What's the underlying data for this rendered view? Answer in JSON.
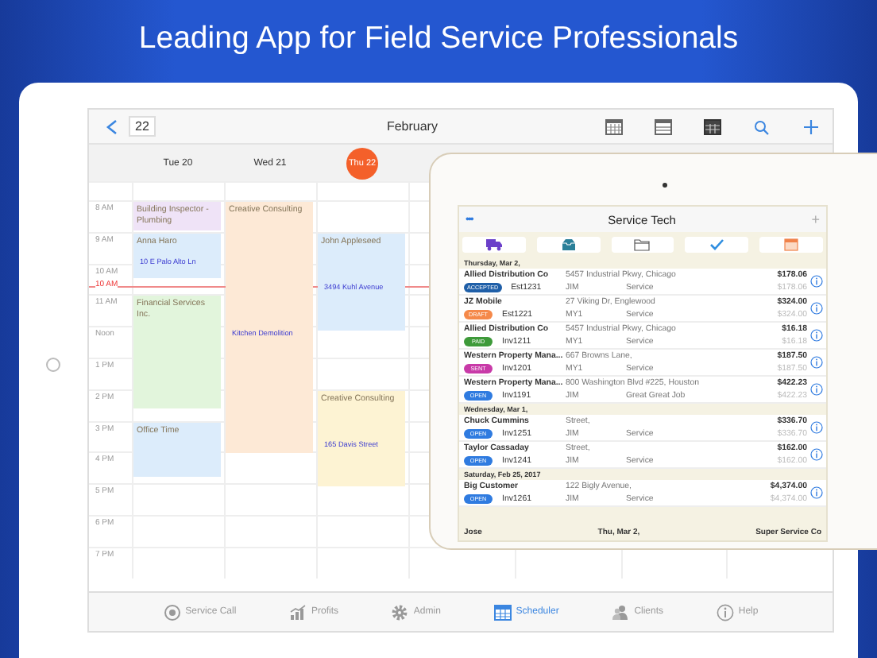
{
  "headline": "Leading App for Field Service Professionals",
  "calendar": {
    "date_box": "22",
    "month": "February",
    "days": [
      {
        "label": "Tue 20",
        "selected": false,
        "events": [
          {
            "title": "Building Inspector -Plumbing",
            "color": "#efe3f7"
          },
          {
            "title": "Anna Haro",
            "detail": "10 E Palo Alto Ln",
            "color": "#dcecfb"
          },
          {
            "title": "Financial Services Inc.",
            "color": "#e2f5dc"
          },
          {
            "title": "Office Time",
            "color": "#dcecfb"
          }
        ]
      },
      {
        "label": "Wed 21",
        "selected": false,
        "events": [
          {
            "title": "Creative Consulting",
            "detail": "Kitchen Demolition",
            "color": "#fde9d6"
          }
        ]
      },
      {
        "label": "Thu 22",
        "selected": true,
        "events": [
          {
            "title": "John Appleseed",
            "detail": "3494 Kuhl Avenue",
            "color": "#dcecfb"
          },
          {
            "title": "Creative Consulting",
            "detail": "165 Davis Street",
            "color": "#fdf3d3"
          }
        ]
      }
    ],
    "time_labels": [
      "8 AM",
      "9 AM",
      "10 AM",
      "11 AM",
      "Noon",
      "1 PM",
      "2 PM",
      "3 PM",
      "4 PM",
      "5 PM",
      "6 PM",
      "7 PM"
    ],
    "now_marker": "10 AM"
  },
  "tab_bar": [
    {
      "label": "Service Call",
      "selected": false
    },
    {
      "label": "Profits",
      "selected": false
    },
    {
      "label": "Admin",
      "selected": false
    },
    {
      "label": "Scheduler",
      "selected": true
    },
    {
      "label": "Clients",
      "selected": false
    },
    {
      "label": "Help",
      "selected": false
    }
  ],
  "service_tech": {
    "title": "Service Tech",
    "menu": "•••",
    "add": "+",
    "sections": [
      {
        "heading": "Thursday, Mar 2,",
        "rows": [
          {
            "name": "Allied Distribution Co",
            "address": "5457 Industrial Pkwy, Chicago",
            "amount": "$178.06",
            "status": "ACCEPTED",
            "color": "#1f5fa8",
            "number": "Est1231",
            "tech": "JIM",
            "job": "Service",
            "subtotal": "$178.06"
          },
          {
            "name": "JZ Mobile",
            "address": "27 Viking Dr, Englewood",
            "amount": "$324.00",
            "status": "DRAFT",
            "color": "#f5894a",
            "number": "Est1221",
            "tech": "MY1",
            "job": "Service",
            "subtotal": "$324.00"
          },
          {
            "name": "Allied Distribution Co",
            "address": "5457 Industrial Pkwy, Chicago",
            "amount": "$16.18",
            "status": "PAID",
            "color": "#3e9a3a",
            "number": "Inv1211",
            "tech": "MY1",
            "job": "Service",
            "subtotal": "$16.18"
          },
          {
            "name": "Western Property Mana...",
            "address": "667 Browns Lane,",
            "amount": "$187.50",
            "status": "SENT",
            "color": "#c83aa8",
            "number": "Inv1201",
            "tech": "MY1",
            "job": "Service",
            "subtotal": "$187.50"
          },
          {
            "name": "Western Property Mana...",
            "address": "800 Washington Blvd #225, Houston",
            "amount": "$422.23",
            "status": "OPEN",
            "color": "#2f7be0",
            "number": "Inv1191",
            "tech": "JIM",
            "job": "Great Great Job",
            "subtotal": "$422.23"
          }
        ]
      },
      {
        "heading": "Wednesday, Mar 1,",
        "rows": [
          {
            "name": "Chuck Cummins",
            "address": "Street,",
            "amount": "$336.70",
            "status": "OPEN",
            "color": "#2f7be0",
            "number": "Inv1251",
            "tech": "JIM",
            "job": "Service",
            "subtotal": "$336.70"
          },
          {
            "name": "Taylor Cassaday",
            "address": "Street,",
            "amount": "$162.00",
            "status": "OPEN",
            "color": "#2f7be0",
            "number": "Inv1241",
            "tech": "JIM",
            "job": "Service",
            "subtotal": "$162.00"
          }
        ]
      },
      {
        "heading": "Saturday, Feb 25, 2017",
        "rows": [
          {
            "name": "Big Customer",
            "address": "122 Bigly Avenue,",
            "amount": "$4,374.00",
            "status": "OPEN",
            "color": "#2f7be0",
            "number": "Inv1261",
            "tech": "JIM",
            "job": "Service",
            "subtotal": "$4,374.00"
          }
        ]
      }
    ],
    "footer": {
      "name": "Jose",
      "date": "Thu, Mar 2,",
      "company": "Super Service Co"
    }
  }
}
